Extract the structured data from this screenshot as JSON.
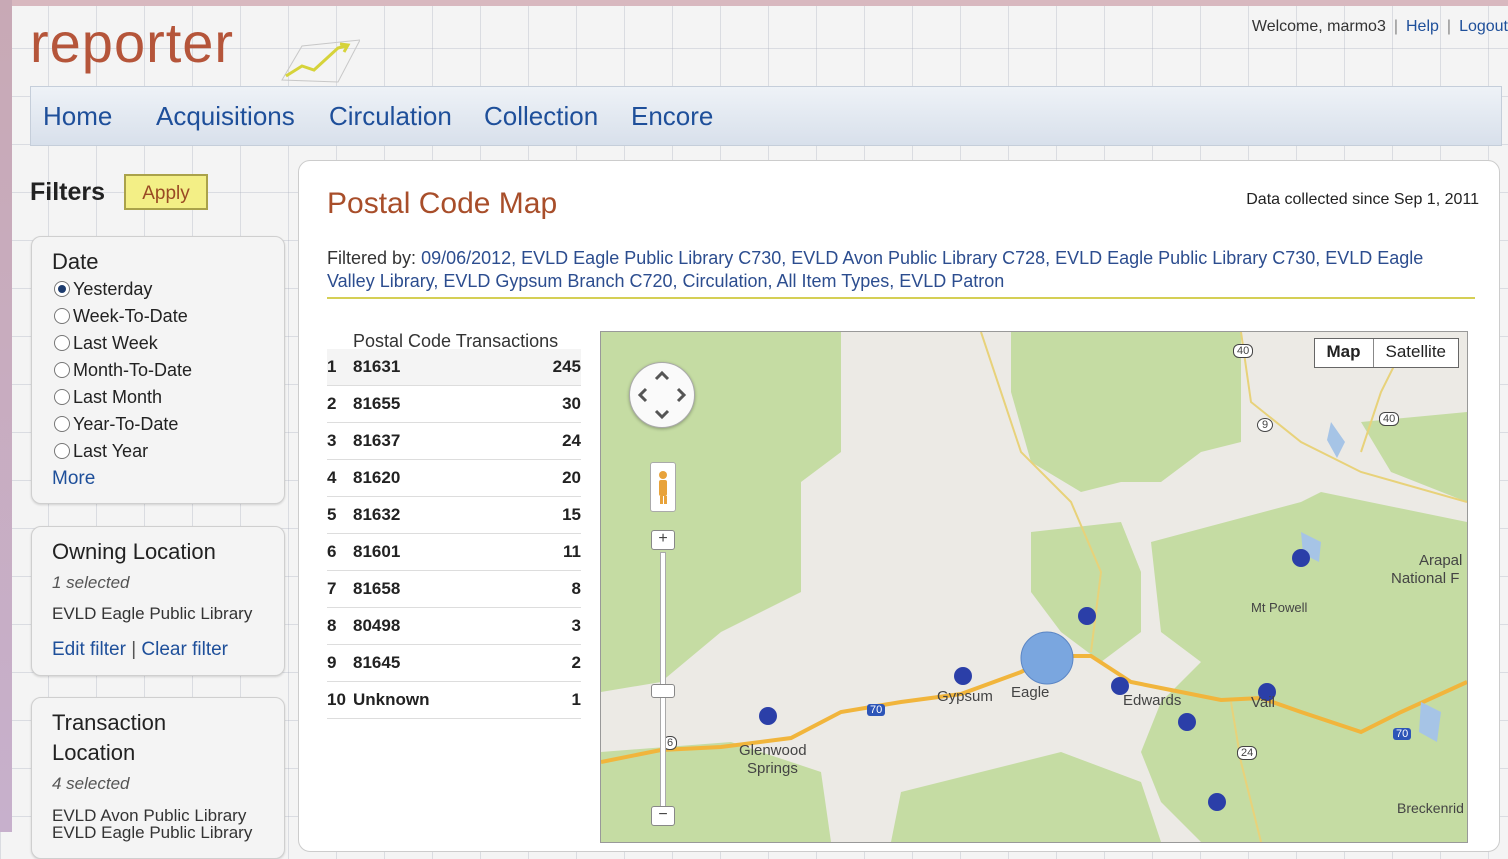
{
  "header": {
    "logo": "reporter",
    "welcome": "Welcome, marmo3",
    "help": "Help",
    "logout": "Logout"
  },
  "nav": [
    "Home",
    "Acquisitions",
    "Circulation",
    "Collection",
    "Encore"
  ],
  "filters": {
    "title": "Filters",
    "apply": "Apply",
    "date": {
      "title": "Date",
      "options": [
        "Yesterday",
        "Week-To-Date",
        "Last Week",
        "Month-To-Date",
        "Last Month",
        "Year-To-Date",
        "Last Year"
      ],
      "selected": "Yesterday",
      "more": "More"
    },
    "owning": {
      "title": "Owning Location",
      "count": "1 selected",
      "item": "EVLD Eagle Public Library",
      "edit": "Edit filter",
      "sep": "|",
      "clear": "Clear filter"
    },
    "transaction": {
      "title1": "Transaction",
      "title2": "Location",
      "count": "4 selected",
      "item1": "EVLD Avon Public Library",
      "item2": "EVLD Eagle Public Library"
    }
  },
  "main": {
    "title": "Postal Code Map",
    "collected": "Data collected since Sep 1, 2011",
    "filtered_label": "Filtered by:",
    "filtered_values": "09/06/2012, EVLD Eagle Public Library C730, EVLD Avon Public Library C728, EVLD Eagle Public Library C730, EVLD Eagle Valley Library, EVLD Gypsum Branch C720, Circulation, All Item Types, EVLD Patron",
    "table_header": "Postal Code Transactions",
    "rows": [
      {
        "rank": "1",
        "code": "81631",
        "count": "245"
      },
      {
        "rank": "2",
        "code": "81655",
        "count": "30"
      },
      {
        "rank": "3",
        "code": "81637",
        "count": "24"
      },
      {
        "rank": "4",
        "code": "81620",
        "count": "20"
      },
      {
        "rank": "5",
        "code": "81632",
        "count": "15"
      },
      {
        "rank": "6",
        "code": "81601",
        "count": "11"
      },
      {
        "rank": "7",
        "code": "81658",
        "count": "8"
      },
      {
        "rank": "8",
        "code": "80498",
        "count": "3"
      },
      {
        "rank": "9",
        "code": "81645",
        "count": "2"
      },
      {
        "rank": "10",
        "code": "Unknown",
        "count": "1"
      }
    ]
  },
  "map": {
    "type_map": "Map",
    "type_satellite": "Satellite",
    "zoom_in": "+",
    "zoom_out": "−",
    "labels": {
      "gypsum": "Gypsum",
      "eagle": "Eagle",
      "edwards": "Edwards",
      "vail": "Vail",
      "glenwood1": "Glenwood",
      "glenwood2": "Springs",
      "mtpowell": "Mt Powell",
      "arapaho1": "Arapal",
      "arapaho2": "National F",
      "breckenridge": "Breckenrid"
    },
    "shields": {
      "us40a": "40",
      "us40b": "40",
      "s9": "9",
      "i70a": "70",
      "i70b": "70",
      "us6": "6",
      "us24": "24"
    },
    "colors": {
      "forest": "#c5dca3",
      "land": "#eceae5",
      "road": "#f1b53c",
      "marker": "#2b3fa8",
      "big_marker": "#7aa6df"
    }
  }
}
